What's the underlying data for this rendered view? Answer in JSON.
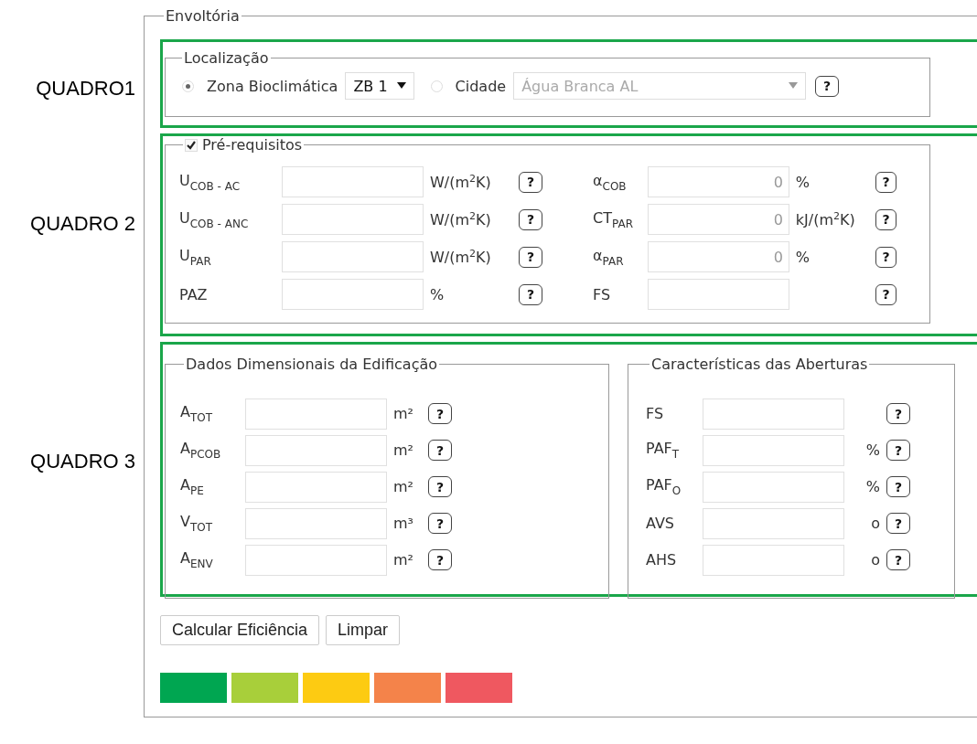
{
  "annotations": [
    "QUADRO1",
    "QUADRO 2",
    "QUADRO 3"
  ],
  "envoltoria": {
    "legend": "Envoltória",
    "localizacao": {
      "legend": "Localização",
      "help": "?",
      "options": [
        {
          "label": "Zona Bioclimática",
          "selected": true,
          "select": {
            "value": "ZB 1",
            "disabled": false
          }
        },
        {
          "label": "Cidade",
          "selected": false,
          "select": {
            "value": "Água Branca AL",
            "disabled": true
          }
        }
      ]
    },
    "prerequisitos": {
      "legend": "Pré-requisitos",
      "checked": true,
      "fields": [
        {
          "label": "U$_{COB - AC}$",
          "unit": "W/(m$^{2}$K)",
          "help": "?"
        },
        {
          "label": "α$_{COB}$",
          "placeholder": "0",
          "unit": "%",
          "help": "?"
        },
        {
          "label": "U$_{COB - ANC}$",
          "unit": "W/(m$^{2}$K)",
          "help": "?"
        },
        {
          "label": "CT$_{PAR}$",
          "placeholder": "0",
          "unit": "kJ/(m$^{2}$K)",
          "help": "?"
        },
        {
          "label": "U$_{PAR}$",
          "unit": "W/(m$^{2}$K)",
          "help": "?"
        },
        {
          "label": "α$_{PAR}$",
          "placeholder": "0",
          "unit": "%",
          "help": "?"
        },
        {
          "label": "PAZ",
          "unit": "%",
          "help": "?"
        },
        {
          "label": "FS",
          "help": "?"
        }
      ]
    },
    "dados_dimensionais": {
      "legend": "Dados Dimensionais da Edificação",
      "fields": [
        {
          "label": "A$_{TOT}$",
          "unit": "m²",
          "help": "?"
        },
        {
          "label": "A$_{PCOB}$",
          "unit": "m²",
          "help": "?"
        },
        {
          "label": "A$_{PE}$",
          "unit": "m²",
          "help": "?"
        },
        {
          "label": "V$_{TOT}$",
          "unit": "m³",
          "help": "?"
        },
        {
          "label": "A$_{ENV}$",
          "unit": "m²",
          "help": "?"
        }
      ]
    },
    "caracteristicas_aberturas": {
      "legend": "Características das Aberturas",
      "fields": [
        {
          "label": "FS",
          "help": "?"
        },
        {
          "label": "PAF$_{T}$",
          "unit": "%",
          "help": "?"
        },
        {
          "label": "PAF$_{O}$",
          "unit": "%",
          "help": "?"
        },
        {
          "label": "AVS",
          "unit": "o",
          "help": "?"
        },
        {
          "label": "AHS",
          "unit": "o",
          "help": "?"
        }
      ]
    },
    "buttons": [
      "Calcular Eficiência",
      "Limpar"
    ],
    "rating_scale": [
      {
        "color": "#00a651"
      },
      {
        "color": "#a8cf3a"
      },
      {
        "color": "#fdcb12"
      },
      {
        "color": "#f4834a"
      },
      {
        "color": "#ef5860"
      }
    ]
  }
}
